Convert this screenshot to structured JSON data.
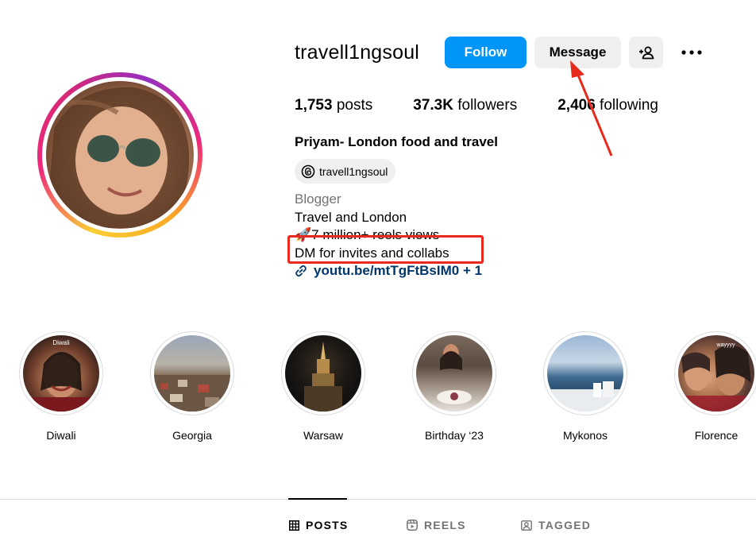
{
  "profile": {
    "username": "travell1ngsoul",
    "follow_label": "Follow",
    "message_label": "Message",
    "stats": [
      {
        "value": "1,753",
        "label": "posts"
      },
      {
        "value": "37.3K",
        "label": "followers"
      },
      {
        "value": "2,406",
        "label": "following"
      }
    ],
    "full_name": "Priyam- London food and travel",
    "threads_handle": "travell1ngsoul",
    "bio": {
      "category": "Blogger",
      "lines": [
        "Travel and London",
        "🚀7 million+ reels views",
        "DM for invites and collabs"
      ],
      "link": "youtu.be/mtTgFtBsIM0 + 1"
    }
  },
  "highlights": [
    {
      "label": "Diwali",
      "overlay": "Diwali"
    },
    {
      "label": "Georgia",
      "overlay": ""
    },
    {
      "label": "Warsaw",
      "overlay": ""
    },
    {
      "label": "Birthday ‘23",
      "overlay": ""
    },
    {
      "label": "Mykonos",
      "overlay": ""
    },
    {
      "label": "Florence",
      "overlay": "wayyyy"
    }
  ],
  "tabs": [
    {
      "label": "POSTS",
      "active": true
    },
    {
      "label": "REELS",
      "active": false
    },
    {
      "label": "TAGGED",
      "active": false
    }
  ],
  "colors": {
    "follow_button": "#0095f6",
    "secondary_button": "#efefef",
    "link": "#00376b",
    "annotation_red": "#e8291c"
  }
}
